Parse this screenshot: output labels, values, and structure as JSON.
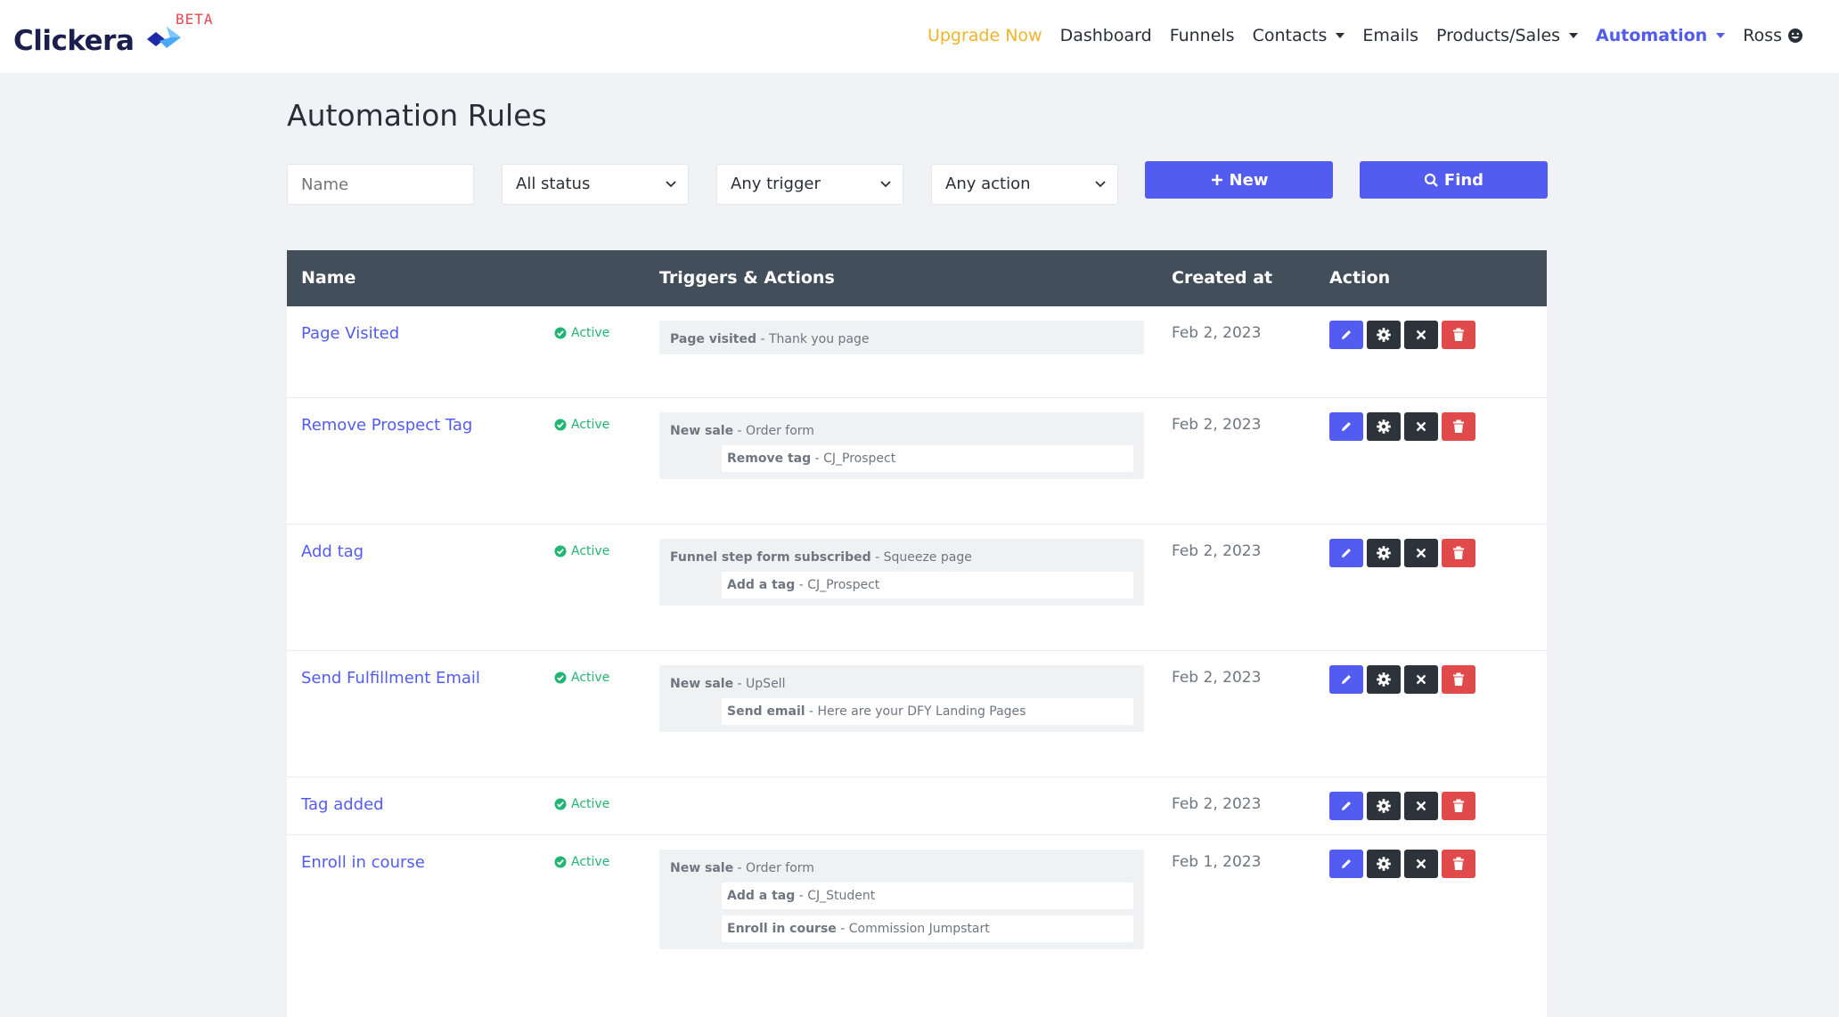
{
  "brand": {
    "name": "Clickera",
    "badge": "BETA"
  },
  "nav": {
    "upgrade": "Upgrade Now",
    "dashboard": "Dashboard",
    "funnels": "Funnels",
    "contacts": "Contacts",
    "emails": "Emails",
    "products": "Products/Sales",
    "automation": "Automation",
    "user": "Ross"
  },
  "page": {
    "title": "Automation Rules"
  },
  "filters": {
    "name_placeholder": "Name",
    "status": "All status",
    "trigger": "Any trigger",
    "action": "Any action",
    "new_label": "New",
    "find_label": "Find"
  },
  "table": {
    "headers": {
      "name": "Name",
      "triggers": "Triggers & Actions",
      "created": "Created at",
      "action": "Action"
    },
    "rows": [
      {
        "name": "Page Visited",
        "status": "Active",
        "created": "Feb 2, 2023",
        "trigger": {
          "label": "Page visited",
          "detail": "Thank you page"
        },
        "actions": []
      },
      {
        "name": "Remove Prospect Tag",
        "status": "Active",
        "created": "Feb 2, 2023",
        "trigger": {
          "label": "New sale",
          "detail": "Order form"
        },
        "actions": [
          {
            "label": "Remove tag",
            "detail": "CJ_Prospect"
          }
        ]
      },
      {
        "name": "Add tag",
        "status": "Active",
        "created": "Feb 2, 2023",
        "trigger": {
          "label": "Funnel step form subscribed",
          "detail": "Squeeze page"
        },
        "actions": [
          {
            "label": "Add a tag",
            "detail": "CJ_Prospect"
          }
        ]
      },
      {
        "name": "Send Fulfillment Email",
        "status": "Active",
        "created": "Feb 2, 2023",
        "trigger": {
          "label": "New sale",
          "detail": "UpSell"
        },
        "actions": [
          {
            "label": "Send email",
            "detail": "Here are your DFY Landing Pages"
          }
        ]
      },
      {
        "name": "Tag added",
        "status": "Active",
        "created": "Feb 2, 2023",
        "trigger": null,
        "actions": []
      },
      {
        "name": "Enroll in course",
        "status": "Active",
        "created": "Feb 1, 2023",
        "trigger": {
          "label": "New sale",
          "detail": "Order form"
        },
        "actions": [
          {
            "label": "Add a tag",
            "detail": "CJ_Student"
          },
          {
            "label": "Enroll in course",
            "detail": "Commission Jumpstart"
          }
        ]
      }
    ]
  },
  "colors": {
    "accent": "#525cf0",
    "upgrade": "#f0b429",
    "status_active": "#22b573",
    "header_bg": "#434e5b",
    "danger": "#e04a4a"
  },
  "icons": {
    "edit": "pencil-icon",
    "settings": "gear-icon",
    "disable": "close-icon",
    "delete": "trash-icon",
    "status": "check-circle-icon",
    "new": "plus-icon",
    "find": "search-icon"
  }
}
